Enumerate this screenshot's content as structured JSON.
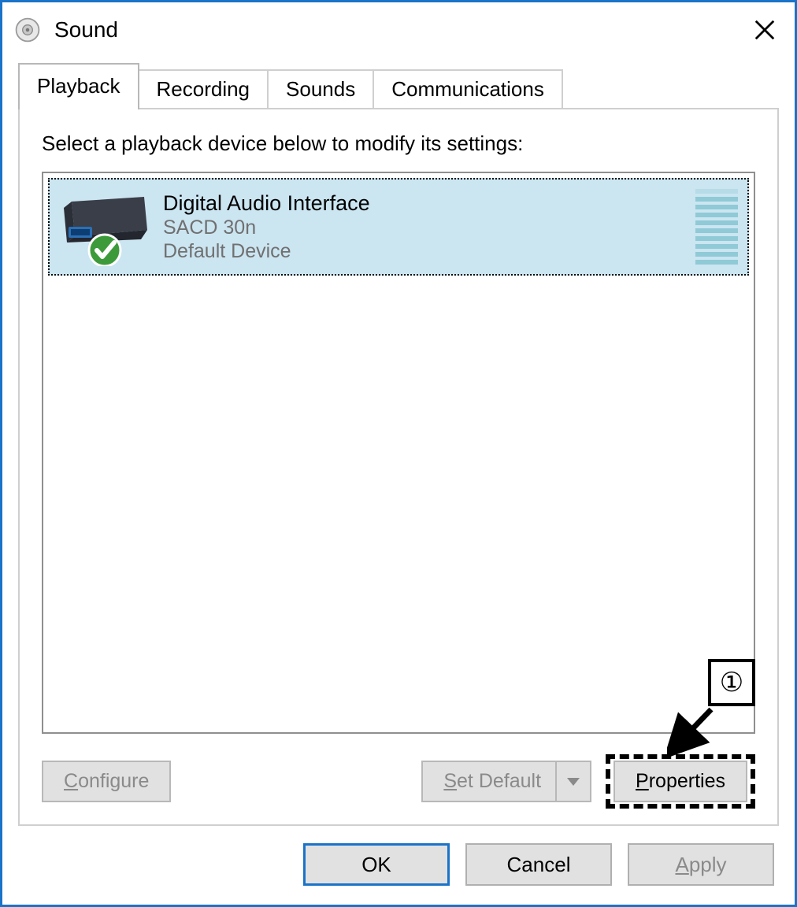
{
  "window": {
    "title": "Sound"
  },
  "tabs": {
    "playback": "Playback",
    "recording": "Recording",
    "sounds": "Sounds",
    "communications": "Communications"
  },
  "instruction": "Select a playback device below to modify its settings:",
  "device": {
    "name": "Digital Audio Interface",
    "subname": "SACD 30n",
    "status": "Default Device"
  },
  "buttons": {
    "configure_accel": "C",
    "configure_rest": "onfigure",
    "setdefault_accel": "S",
    "setdefault_rest": "et Default",
    "properties_accel": "P",
    "properties_rest": "roperties",
    "ok": "OK",
    "cancel": "Cancel",
    "apply_accel": "A",
    "apply_rest": "pply"
  },
  "annotation": {
    "label": "①"
  }
}
